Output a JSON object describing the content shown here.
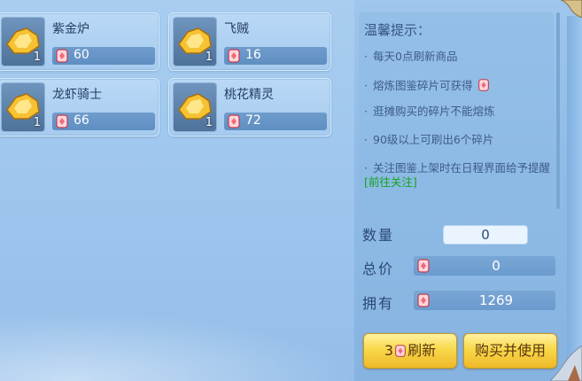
{
  "items": [
    {
      "name": "紫金炉",
      "qty": "1",
      "price": "60"
    },
    {
      "name": "飞贼",
      "qty": "1",
      "price": "16"
    },
    {
      "name": "龙虾骑士",
      "qty": "1",
      "price": "66"
    },
    {
      "name": "桃花精灵",
      "qty": "1",
      "price": "72"
    }
  ],
  "tips": {
    "title": "温馨提示：",
    "lines": [
      "每天0点刷新商品",
      "熔炼图鉴碎片可获得",
      "逛摊购买的碎片不能熔炼",
      "90级以上可刷出6个碎片",
      "关注图鉴上架时在日程界面给予提醒",
      "[前往关注]"
    ]
  },
  "purchase": {
    "qty_label": "数量",
    "qty_value": "0",
    "total_label": "总价",
    "total_value": "0",
    "own_label": "拥有",
    "own_value": "1269"
  },
  "buttons": {
    "refresh_cost": "3",
    "refresh_label": "刷新",
    "buy_label": "购买并使用"
  },
  "colors": {
    "coin": "#f26a7a",
    "link": "#11a31c",
    "button": "#f8d94a"
  },
  "icons": [
    "treasure-fragment-icon",
    "currency-coin-icon"
  ]
}
